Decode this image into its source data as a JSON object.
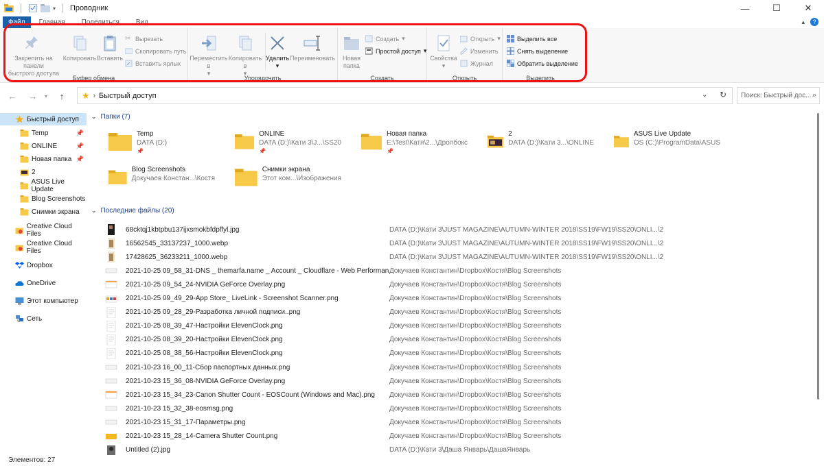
{
  "window": {
    "title": "Проводник"
  },
  "tabs": [
    {
      "label": "Файл"
    },
    {
      "label": "Главная"
    },
    {
      "label": "Поделиться"
    },
    {
      "label": "Вид"
    }
  ],
  "ribbon": {
    "clipboard": {
      "label": "Буфер обмена",
      "pin_line1": "Закрепить на панели",
      "pin_line2": "быстрого доступа",
      "copy": "Копировать",
      "paste": "Вставить",
      "cut": "Вырезать",
      "copy_path": "Скопировать путь",
      "paste_shortcut": "Вставить ярлык"
    },
    "organize": {
      "label": "Упорядочить",
      "move_line1": "Переместить",
      "move_line2": "в",
      "copyto_line1": "Копировать",
      "copyto_line2": "в",
      "delete": "Удалить",
      "rename": "Переименовать"
    },
    "create": {
      "label": "Создать",
      "new_folder_line1": "Новая",
      "new_folder_line2": "папка",
      "new_item": "Создать",
      "easy_access": "Простой доступ"
    },
    "open": {
      "label": "Открыть",
      "properties": "Свойства",
      "open": "Открыть",
      "edit": "Изменить",
      "history": "Журнал"
    },
    "select": {
      "label": "Выделить",
      "select_all": "Выделить все",
      "select_none": "Снять выделение",
      "invert": "Обратить выделение"
    }
  },
  "address": {
    "path": "Быстрый доступ",
    "search_placeholder": "Поиск: Быстрый дос..."
  },
  "sidebar": {
    "items": [
      {
        "label": "Быстрый доступ",
        "icon": "star-icon",
        "selected": true
      },
      {
        "label": "Temp",
        "icon": "folder-icon",
        "pinned": true
      },
      {
        "label": "ONLINE",
        "icon": "folder-icon",
        "pinned": true
      },
      {
        "label": "Новая папка",
        "icon": "folder-icon",
        "pinned": true
      },
      {
        "label": "2",
        "icon": "image-folder-icon"
      },
      {
        "label": "ASUS Live Update",
        "icon": "folder-icon"
      },
      {
        "label": "Blog Screenshots",
        "icon": "folder-icon"
      },
      {
        "label": "Снимки экрана",
        "icon": "folder-icon"
      },
      {
        "label": "Creative Cloud Files",
        "icon": "creative-cloud-icon"
      },
      {
        "label": "Creative Cloud Files",
        "icon": "creative-cloud-icon"
      },
      {
        "label": "Dropbox",
        "icon": "dropbox-icon"
      },
      {
        "label": "OneDrive",
        "icon": "onedrive-icon"
      },
      {
        "label": "Этот компьютер",
        "icon": "computer-icon"
      },
      {
        "label": "Сеть",
        "icon": "network-icon"
      }
    ]
  },
  "folders": {
    "header": "Папки (7)",
    "items": [
      {
        "name": "Temp",
        "path": "DATA (D:)",
        "pinned": true
      },
      {
        "name": "ONLINE",
        "path": "DATA (D:)\\Кати 3\\J...\\SS20",
        "pinned": true
      },
      {
        "name": "Новая папка",
        "path": "E:\\Test\\Катя\\2...\\Дропбокс",
        "pinned": true
      },
      {
        "name": "2",
        "path": "DATA (D:)\\Кати 3...\\ONLINE",
        "pinned": false
      },
      {
        "name": "ASUS Live Update",
        "path": "OS (C:)\\ProgramData\\ASUS",
        "pinned": false
      },
      {
        "name": "Blog Screenshots",
        "path": "Докучаев Констан...\\Костя",
        "pinned": false
      },
      {
        "name": "Снимки экрана",
        "path": "Этот ком...\\Изображения",
        "pinned": false
      }
    ]
  },
  "recent": {
    "header": "Последние файлы (20)",
    "items": [
      {
        "name": "68cktqj1kbtpbu137ijxsmokbfdpffyl.jpg",
        "path": "DATA (D:)\\Кати 3\\JUST MAGAZINE\\AUTUMN-WINTER 2018\\SS19\\FW19\\SS20\\ONLI...\\2",
        "thumb": "dark"
      },
      {
        "name": "16562545_33137237_1000.webp",
        "path": "DATA (D:)\\Кати 3\\JUST MAGAZINE\\AUTUMN-WINTER 2018\\SS19\\FW19\\SS20\\ONLI...\\2",
        "thumb": "beige"
      },
      {
        "name": "17428625_36233211_1000.webp",
        "path": "DATA (D:)\\Кати 3\\JUST MAGAZINE\\AUTUMN-WINTER 2018\\SS19\\FW19\\SS20\\ONLI...\\2",
        "thumb": "beige"
      },
      {
        "name": "2021-10-25 09_58_31-DNS _ themarfa.name _ Account _ Cloudflare - Web Performan...",
        "path": "Докучаев Константин\\Dropbox\\Костя\\Blog Screenshots",
        "thumb": "light"
      },
      {
        "name": "2021-10-25 09_54_24-NVIDIA GeForce Overlay.png",
        "path": "Докучаев Константин\\Dropbox\\Костя\\Blog Screenshots",
        "thumb": "window"
      },
      {
        "name": "2021-10-25 09_49_29-App Store_ LiveLink - Screenshot Scanner.png",
        "path": "Докучаев Константин\\Dropbox\\Костя\\Blog Screenshots",
        "thumb": "colorful"
      },
      {
        "name": "2021-10-25 09_28_29-Разработка личной подписи..png",
        "path": "Докучаев Константин\\Dropbox\\Костя\\Blog Screenshots",
        "thumb": "doc"
      },
      {
        "name": "2021-10-25 08_39_47-Настройки ElevenClock.png",
        "path": "Докучаев Константин\\Dropbox\\Костя\\Blog Screenshots",
        "thumb": "doc"
      },
      {
        "name": "2021-10-25 08_39_20-Настройки ElevenClock.png",
        "path": "Докучаев Константин\\Dropbox\\Костя\\Blog Screenshots",
        "thumb": "doc"
      },
      {
        "name": "2021-10-25 08_38_56-Настройки ElevenClock.png",
        "path": "Докучаев Константин\\Dropbox\\Костя\\Blog Screenshots",
        "thumb": "doc"
      },
      {
        "name": "2021-10-23 16_00_11-Сбор паспортных данных.png",
        "path": "Докучаев Константин\\Dropbox\\Костя\\Blog Screenshots",
        "thumb": "light"
      },
      {
        "name": "2021-10-23 15_36_08-NVIDIA GeForce Overlay.png",
        "path": "Докучаев Константин\\Dropbox\\Костя\\Blog Screenshots",
        "thumb": "light"
      },
      {
        "name": "2021-10-23 15_34_23-Canon Shutter Count - EOSCount (Windows and Mac).png",
        "path": "Докучаев Константин\\Dropbox\\Костя\\Blog Screenshots",
        "thumb": "window"
      },
      {
        "name": "2021-10-23 15_32_38-eosmsg.png",
        "path": "Докучаев Константин\\Dropbox\\Костя\\Blog Screenshots",
        "thumb": "light"
      },
      {
        "name": "2021-10-23 15_31_17-Параметры.png",
        "path": "Докучаев Константин\\Dropbox\\Костя\\Blog Screenshots",
        "thumb": "light"
      },
      {
        "name": "2021-10-23 15_28_14-Camera Shutter Count.png",
        "path": "Докучаев Константин\\Dropbox\\Костя\\Blog Screenshots",
        "thumb": "yellow"
      },
      {
        "name": "Untitled (2).jpg",
        "path": "DATA (D:)\\Кати 3\\Даша Январь\\ДашаЯнварь",
        "thumb": "photo"
      }
    ]
  },
  "status": {
    "items_count": "Элементов: 27"
  },
  "colors": {
    "accent": "#1a5fa8",
    "selection": "#cce4f7",
    "folder": "#f7c948",
    "highlight": "#e11111"
  }
}
